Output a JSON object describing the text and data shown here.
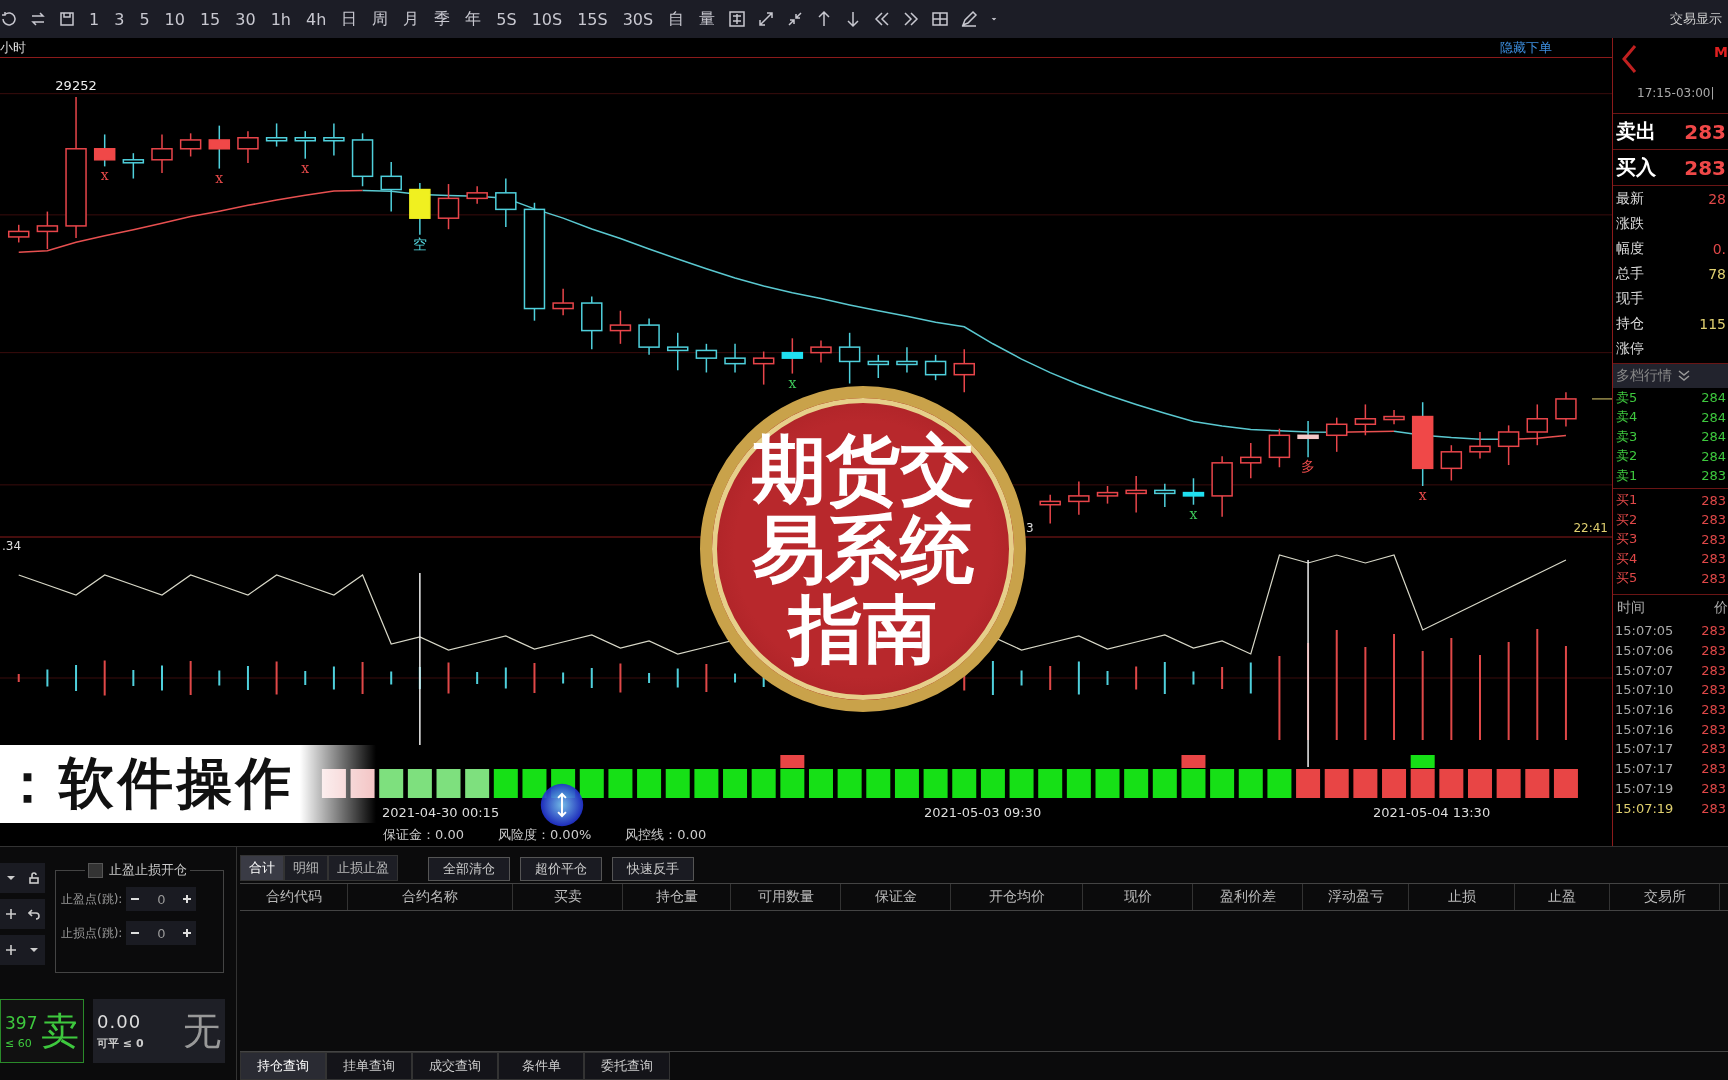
{
  "toolbar": {
    "periods": [
      "1",
      "3",
      "5",
      "10",
      "15",
      "30",
      "1h",
      "4h",
      "日",
      "周",
      "月",
      "季",
      "年",
      "5S",
      "10S",
      "15S",
      "30S",
      "自",
      "量"
    ],
    "trade_display": "交易显示"
  },
  "chart": {
    "period": "小时",
    "hide_order": "隐藏下单",
    "high_label": "29252",
    "time_label": "22:41",
    "partial_label": "3",
    "indicator_value": ".34",
    "markers": [
      "x",
      "x",
      "x",
      "空",
      "x",
      "x",
      "多",
      "x"
    ]
  },
  "time_axis": [
    "2021-04-30 00:15",
    "2021-05-03 09:30",
    "2021-05-04 13:30"
  ],
  "account": [
    "保证金：0.00",
    "风险度：0.00%",
    "风控线：0.00"
  ],
  "quote": {
    "contract": "M",
    "session": "17:15-03:00|",
    "sell": {
      "label": "卖出",
      "price": "283"
    },
    "buy": {
      "label": "买入",
      "price": "283"
    },
    "stats": [
      {
        "label": "最新",
        "value": "28",
        "color": "#e04848"
      },
      {
        "label": "涨跌"
      },
      {
        "label": "幅度",
        "value": "0.",
        "color": "#e04848"
      },
      {
        "label": "总手",
        "value": "78",
        "color": "#e0d070"
      },
      {
        "label": "现手"
      },
      {
        "label": "持仓",
        "value": "115",
        "color": "#e0d070"
      },
      {
        "label": "涨停"
      }
    ],
    "depth_title": "多档行情",
    "asks": [
      {
        "label": "卖5",
        "price": "284"
      },
      {
        "label": "卖4",
        "price": "284"
      },
      {
        "label": "卖3",
        "price": "284"
      },
      {
        "label": "卖2",
        "price": "284"
      },
      {
        "label": "卖1",
        "price": "283"
      }
    ],
    "bids": [
      {
        "label": "买1",
        "price": "283"
      },
      {
        "label": "买2",
        "price": "283"
      },
      {
        "label": "买3",
        "price": "283"
      },
      {
        "label": "买4",
        "price": "283"
      },
      {
        "label": "买5",
        "price": "283"
      }
    ],
    "ticks_header": [
      "时间",
      "价"
    ],
    "ticks": [
      {
        "time": "15:07:05",
        "price": "283",
        "selected": false
      },
      {
        "time": "15:07:06",
        "price": "283",
        "selected": false
      },
      {
        "time": "15:07:07",
        "price": "283",
        "selected": false
      },
      {
        "time": "15:07:10",
        "price": "283",
        "selected": false
      },
      {
        "time": "15:07:16",
        "price": "283",
        "selected": false
      },
      {
        "time": "15:07:16",
        "price": "283",
        "selected": false
      },
      {
        "time": "15:07:17",
        "price": "283",
        "selected": false
      },
      {
        "time": "15:07:17",
        "price": "283",
        "selected": false
      },
      {
        "time": "15:07:19",
        "price": "283",
        "selected": false
      },
      {
        "time": "15:07:19",
        "price": "283",
        "selected": true
      }
    ]
  },
  "order_panel": {
    "tp_sl_label": "止盈止损开仓",
    "tp_sl_checked": false,
    "take_profit": {
      "label": "止盈点(跳):",
      "value": "0"
    },
    "stop_loss": {
      "label": "止损点(跳):",
      "value": "0"
    },
    "sell_tile": {
      "price": "397",
      "limit": "≤ 60",
      "action": "卖"
    },
    "close_tile": {
      "price": "0.00",
      "limit": "可平 ≤ 0",
      "action": "无"
    }
  },
  "positions": {
    "tabs": [
      {
        "label": "合计",
        "selected": true
      },
      {
        "label": "明细",
        "selected": false
      },
      {
        "label": "止损止盈",
        "selected": false
      }
    ],
    "actions": [
      "全部清仓",
      "超价平仓",
      "快速反手"
    ],
    "columns": [
      "合约代码",
      "合约名称",
      "买卖",
      "持仓量",
      "可用数量",
      "保证金",
      "开仓均价",
      "现价",
      "盈利价差",
      "浮动盈亏",
      "止损",
      "止盈",
      "交易所"
    ],
    "query_tabs": [
      {
        "label": "持仓查询",
        "selected": true
      },
      {
        "label": "挂单查询",
        "selected": false
      },
      {
        "label": "成交查询",
        "selected": false
      },
      {
        "label": "条件单",
        "selected": false
      },
      {
        "label": "委托查询",
        "selected": false
      }
    ]
  },
  "overlay": {
    "badge": [
      "期货交",
      "易系统",
      "指南"
    ],
    "banner": "：软件操作"
  }
}
